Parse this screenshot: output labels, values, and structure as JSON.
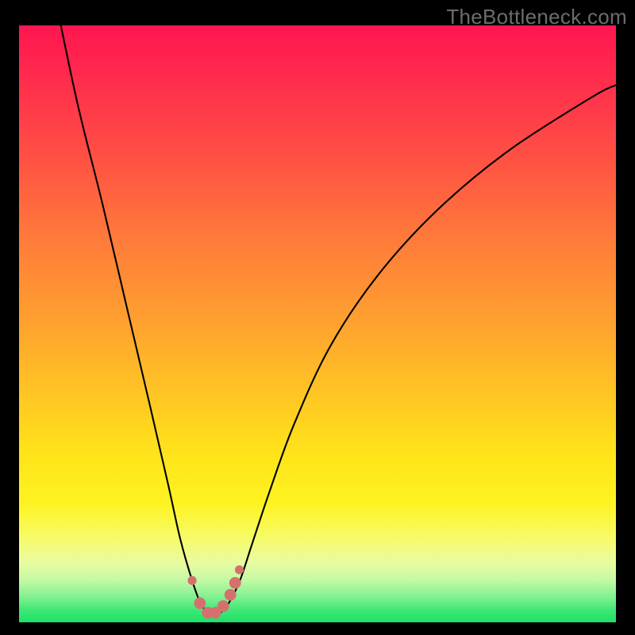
{
  "watermark": "TheBottleneck.com",
  "chart_data": {
    "type": "line",
    "title": "",
    "xlabel": "",
    "ylabel": "",
    "xlim": [
      0,
      100
    ],
    "ylim": [
      0,
      100
    ],
    "gradient_stops": [
      {
        "pos": 0.0,
        "color": "#ff1650"
      },
      {
        "pos": 0.1,
        "color": "#ff2f4c"
      },
      {
        "pos": 0.22,
        "color": "#ff5043"
      },
      {
        "pos": 0.36,
        "color": "#ff7b3a"
      },
      {
        "pos": 0.5,
        "color": "#ffa22f"
      },
      {
        "pos": 0.62,
        "color": "#ffc623"
      },
      {
        "pos": 0.72,
        "color": "#ffe41a"
      },
      {
        "pos": 0.8,
        "color": "#fdf321"
      },
      {
        "pos": 0.86,
        "color": "#f7fb6a"
      },
      {
        "pos": 0.9,
        "color": "#e9fba1"
      },
      {
        "pos": 0.93,
        "color": "#c3f9a4"
      },
      {
        "pos": 0.96,
        "color": "#7bf08f"
      },
      {
        "pos": 0.98,
        "color": "#3de773"
      },
      {
        "pos": 1.0,
        "color": "#1ee169"
      }
    ],
    "series": [
      {
        "name": "bottleneck-curve",
        "stroke": "#000000",
        "stroke_width": 2.1,
        "x": [
          7,
          10,
          14,
          18,
          22,
          25,
          27,
          29,
          30.5,
          32,
          33.5,
          35,
          37,
          39,
          42,
          46,
          52,
          60,
          70,
          82,
          96,
          100
        ],
        "y": [
          100,
          86,
          70,
          53,
          36,
          23,
          14,
          7,
          3,
          1.5,
          1.5,
          3,
          7,
          13,
          22,
          33,
          46,
          58,
          69,
          79,
          88,
          90
        ]
      }
    ],
    "markers": {
      "color": "#d6706f",
      "radius_small": 5.6,
      "radius_large": 7.4,
      "points": [
        {
          "x": 29.0,
          "y": 7.0,
          "r": "small"
        },
        {
          "x": 30.3,
          "y": 3.2,
          "r": "large"
        },
        {
          "x": 31.6,
          "y": 1.6,
          "r": "large"
        },
        {
          "x": 32.9,
          "y": 1.6,
          "r": "large"
        },
        {
          "x": 34.2,
          "y": 2.7,
          "r": "large"
        },
        {
          "x": 35.4,
          "y": 4.6,
          "r": "large"
        },
        {
          "x": 36.2,
          "y": 6.6,
          "r": "large"
        },
        {
          "x": 36.9,
          "y": 8.8,
          "r": "small"
        }
      ]
    }
  }
}
